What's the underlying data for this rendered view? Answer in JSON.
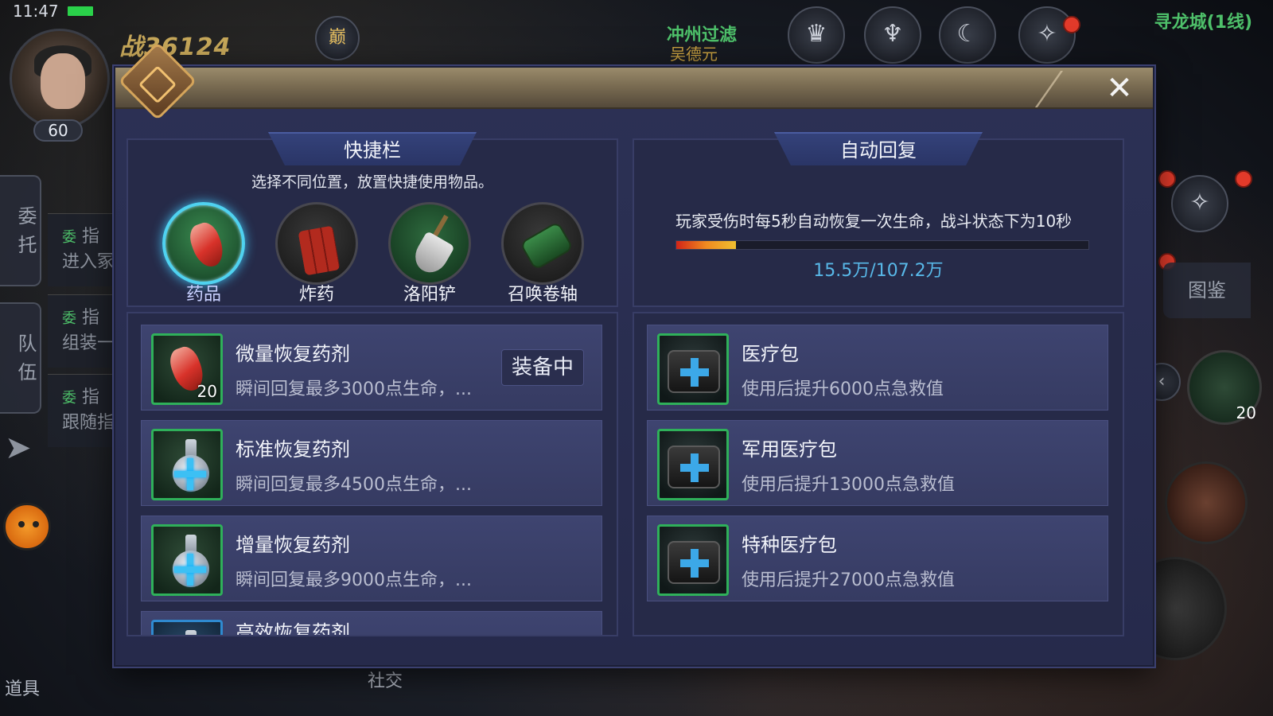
{
  "hud": {
    "time": "11:47",
    "player_level": "60",
    "power": "战36124",
    "peak_badge": "巅",
    "zone_title": "冲州过滤",
    "zone_sub": "吴德元",
    "server": "寻龙城(1线)",
    "side_tabs": [
      "委托",
      "队伍"
    ],
    "quests": [
      {
        "tag": "委",
        "type": "指",
        "text": "进入冢"
      },
      {
        "tag": "委",
        "type": "指",
        "text": "组装一"
      },
      {
        "tag": "委",
        "type": "指",
        "text": "跟随指"
      }
    ],
    "tujian": "图鉴",
    "bottom_items": "道具",
    "bottom_social": "社交",
    "quick_count": "20"
  },
  "dialog": {
    "close_label": "✕",
    "quickbar": {
      "title": "快捷栏",
      "desc": "选择不同位置，放置快捷使用物品。",
      "slots": [
        {
          "label": "药品",
          "active": true
        },
        {
          "label": "炸药"
        },
        {
          "label": "洛阳铲"
        },
        {
          "label": "召唤卷轴"
        }
      ]
    },
    "autoregen": {
      "title": "自动回复",
      "desc": "玩家受伤时每5秒自动恢复一次生命，战斗状态下为10秒",
      "value_text": "15.5万/107.2万",
      "progress": 0.145
    },
    "potions": [
      {
        "name": "微量恢复药剂",
        "desc": "瞬间回复最多3000点生命，...",
        "count": "20",
        "equipped": "装备中"
      },
      {
        "name": "标准恢复药剂",
        "desc": "瞬间回复最多4500点生命，..."
      },
      {
        "name": "增量恢复药剂",
        "desc": "瞬间回复最多9000点生命，..."
      },
      {
        "name": "高效恢复药剂"
      }
    ],
    "medkits": [
      {
        "name": "医疗包",
        "desc": "使用后提升6000点急救值"
      },
      {
        "name": "军用医疗包",
        "desc": "使用后提升13000点急救值"
      },
      {
        "name": "特种医疗包",
        "desc": "使用后提升27000点急救值"
      }
    ]
  }
}
